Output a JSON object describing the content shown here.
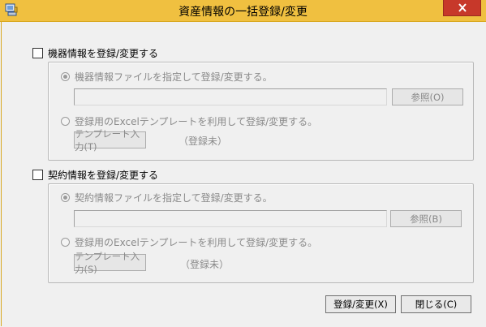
{
  "window": {
    "title": "資産情報の一括登録/変更",
    "icon": "app-icon",
    "close_icon": "close-icon"
  },
  "equipment": {
    "checkbox_label": "機器情報を登録/変更する",
    "checked": false,
    "radio_file_label": "機器情報ファイルを指定して登録/変更する。",
    "file_path_value": "",
    "browse_label": "参照(O)",
    "radio_excel_label": "登録用のExcelテンプレートを利用して登録/変更する。",
    "template_button_label": "テンプレート入力(T)",
    "template_status": "（登録未）"
  },
  "contract": {
    "checkbox_label": "契約情報を登録/変更する",
    "checked": false,
    "radio_file_label": "契約情報ファイルを指定して登録/変更する。",
    "file_path_value": "",
    "browse_label": "参照(B)",
    "radio_excel_label": "登録用のExcelテンプレートを利用して登録/変更する。",
    "template_button_label": "テンプレート入力(S)",
    "template_status": "（登録未）"
  },
  "footer": {
    "submit_label": "登録/変更(X)",
    "close_label": "閉じる(C)"
  },
  "colors": {
    "titlebar": "#f0c040",
    "close_button": "#c7382a",
    "disabled_text": "#8a8a8a"
  }
}
